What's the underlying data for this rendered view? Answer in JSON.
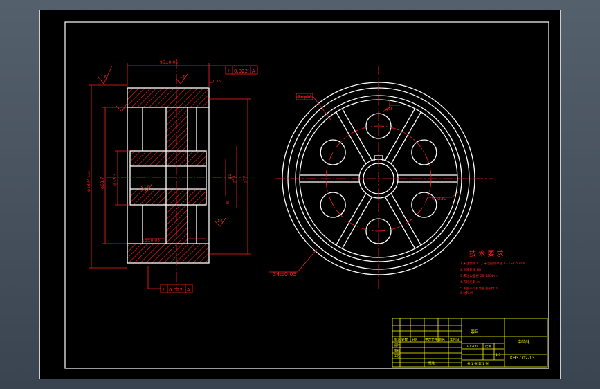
{
  "colors": {
    "background": "#000000",
    "frame": "#ffffff",
    "outline": "#ffffff",
    "dimension": "#ff2020",
    "centerline": "#ff2020",
    "section_hatch": "#ff2020",
    "title_block": "#ffff00"
  },
  "side_view": {
    "width_dim": "96±0.05",
    "roughness_left": "1.6",
    "roughness_top": "1.6",
    "roughness_mid": "1.6",
    "roughness_right": "1.6",
    "tol_top_sym": "/",
    "tol_top_val": "0.022",
    "tol_top_ref": "A",
    "tol_bottom_sym": "/",
    "tol_bottom_val": "0.022",
    "tol_bottom_ref": "A",
    "chamfer": "0.15",
    "dia_outer": "φ180⁰₋₀.₀₅",
    "dia_hub": "φ68.7",
    "dia_bore": "φ32.3",
    "dia_right_1": "φ1",
    "dia_right_2": "φ53",
    "dia_right_3": "φ77",
    "datum": "B",
    "web_width": "16±0.05"
  },
  "front_view": {
    "hole_callout": "7×φ20",
    "bore_tol": "φ18",
    "holes_callout": "6–φ30",
    "keyway_dim": "34±0.05"
  },
  "tech_notes": {
    "title": "技 术 要 求",
    "lines": [
      "1.未注倒角 C1，未注圆角半径 R=1~1.5 mm",
      "2.调质处理 HB",
      "3.未注公差按 GB 1804-m",
      "4.去除毛刺 m",
      "5.表面不得有划痕及裂纹 m",
      "6.材料45"
    ]
  },
  "title_block": {
    "part_label": "零号",
    "part_name": "中齿轮",
    "drawing_no": "KH37.02-13",
    "material_label": "HT200",
    "scale_label": "比例",
    "qty_label": "1:3",
    "sheet_label": "共 1 张 第 1 张",
    "row_labels": [
      "标记",
      "处数",
      "分区",
      "更改文件号",
      "签名",
      "年月日"
    ],
    "left_labels": [
      "设计",
      "审核",
      "工艺",
      "批准"
    ]
  }
}
